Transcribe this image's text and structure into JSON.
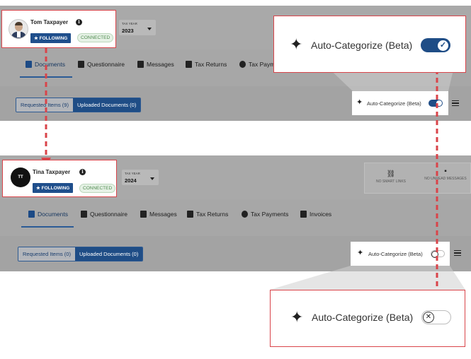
{
  "top": {
    "user_name": "Tom Taxpayer",
    "follow_label": "★ FOLLOWING",
    "connected_label": "CONNECTED",
    "tax_year_label": "TAX YEAR",
    "tax_year_value": "2023",
    "tabs": [
      {
        "label": "Documents"
      },
      {
        "label": "Questionnaire"
      },
      {
        "label": "Messages"
      },
      {
        "label": "Tax Returns"
      },
      {
        "label": "Tax Paym"
      }
    ],
    "requested_label": "Requested Items (9)",
    "uploaded_label": "Uploaded Documents (0)",
    "auto_label": "Auto-Categorize (Beta)",
    "auto_enabled": true
  },
  "bottom": {
    "user_name": "Tina Taxpayer",
    "initials": "TT",
    "follow_label": "★ FOLLOWING",
    "connected_label": "CONNECTED",
    "tax_year_label": "TAX YEAR",
    "tax_year_value": "2024",
    "tabs": [
      {
        "label": "Documents"
      },
      {
        "label": "Questionnaire"
      },
      {
        "label": "Messages"
      },
      {
        "label": "Tax Returns"
      },
      {
        "label": "Tax Payments"
      },
      {
        "label": "Invoices"
      }
    ],
    "stats": [
      {
        "icon": "link-icon",
        "label": "NO SMART LINKS"
      },
      {
        "icon": "message-icon",
        "label": "NO UNREAD MESSAGES"
      }
    ],
    "requested_label": "Requested Items (0)",
    "uploaded_label": "Uploaded Documents (0)",
    "auto_label": "Auto-Categorize (Beta)",
    "auto_enabled": false
  },
  "callouts": {
    "top_label": "Auto-Categorize (Beta)",
    "bottom_label": "Auto-Categorize (Beta)"
  },
  "colors": {
    "accent": "#1f4d86",
    "highlight": "#d9444a",
    "connected": "#4f8a4f"
  }
}
